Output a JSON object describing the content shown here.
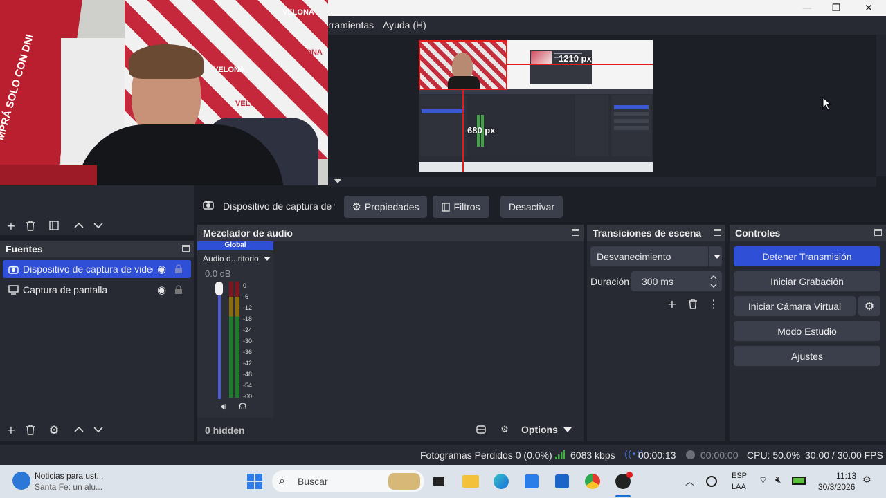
{
  "window": {
    "menu": [
      "rramientas",
      "Ayuda (H)"
    ],
    "controls": {
      "minimize": "—",
      "maximize": "❐",
      "close": "✕"
    }
  },
  "webcam": {
    "banner_text": "MPRÁ SOLO CON DNI",
    "brand": "VELONA"
  },
  "preview": {
    "width_label": "1210 px",
    "height_label": "680 px"
  },
  "source_toolbar": {
    "source_name": "Dispositivo de captura de v",
    "properties": "Propiedades",
    "filters": "Filtros",
    "deactivate": "Desactivar"
  },
  "sources": {
    "title": "Fuentes",
    "items": [
      {
        "label": "Dispositivo de captura de video",
        "icon": "camera-icon",
        "selected": true
      },
      {
        "label": "Captura de pantalla",
        "icon": "monitor-icon",
        "selected": false
      }
    ]
  },
  "mixer": {
    "title": "Mezclador de audio",
    "global_label": "Global",
    "channel_name": "Audio d...ritorio",
    "db_value": "0.0 dB",
    "scale": [
      "0",
      "-6",
      "-12",
      "-18",
      "-24",
      "-30",
      "-36",
      "-42",
      "-48",
      "-54",
      "-60"
    ],
    "hidden_label": "0 hidden",
    "options_label": "Options"
  },
  "transitions": {
    "title": "Transiciones de escena",
    "selected": "Desvanecimiento",
    "duration_label": "Duración",
    "duration_value": "300 ms"
  },
  "controls": {
    "title": "Controles",
    "stop_stream": "Detener Transmisión",
    "start_recording": "Iniciar Grabación",
    "virtual_cam": "Iniciar Cámara Virtual",
    "studio_mode": "Modo Estudio",
    "settings": "Ajustes"
  },
  "status": {
    "dropped_frames": "Fotogramas Perdidos 0 (0.0%)",
    "bitrate": "6083 kbps",
    "stream_time": "00:00:13",
    "record_time": "00:00:00",
    "cpu": "CPU: 50.0%",
    "fps": "30.00 / 30.00 FPS",
    "colors": {
      "accent": "#2f4fd6",
      "bitrate_icon": "#3fb23f"
    }
  },
  "taskbar": {
    "news_title": "Noticias para ust...",
    "news_sub": "Santa Fe: un alu...",
    "search_placeholder": "Buscar",
    "lang_top": "ESP",
    "lang_bottom": "LAA",
    "time": "11:13",
    "date": "30/3/2026"
  }
}
